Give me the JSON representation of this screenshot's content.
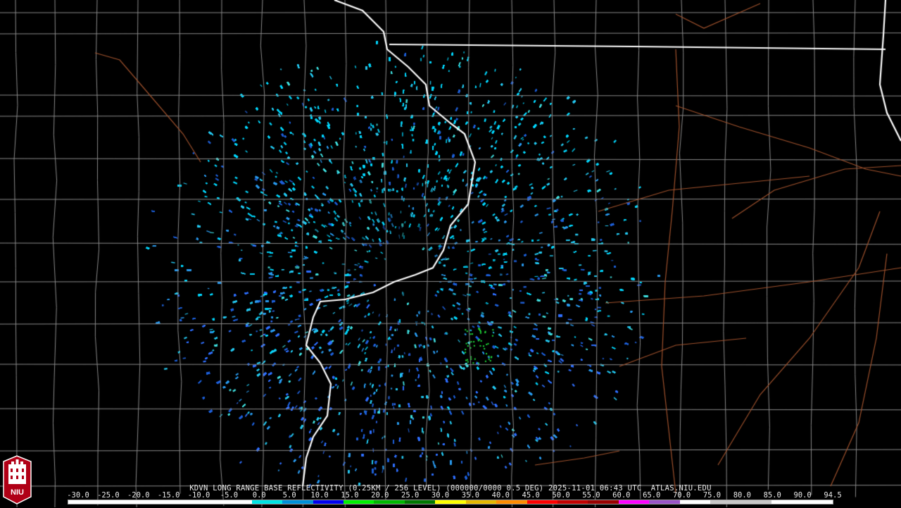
{
  "product": {
    "caption": "KDVN LONG RANGE BASE REFLECTIVITY (0.25KM / 256 LEVEL) (000000/0000 0.5 DEG) 2025-11-01 06:43 UTC  ATLAS.NIU.EDU",
    "logo_text": "NIU",
    "logo_icon": "university-tower-icon"
  },
  "colorbar": {
    "tick_labels": [
      "-30.0",
      "-25.0",
      "-20.0",
      "-15.0",
      "-10.0",
      "-5.0",
      "0.0",
      "5.0",
      "10.0",
      "15.0",
      "20.0",
      "25.0",
      "30.0",
      "35.0",
      "40.0",
      "45.0",
      "50.0",
      "55.0",
      "60.0",
      "65.0",
      "70.0",
      "75.0",
      "80.0",
      "85.0",
      "90.0",
      "94.5"
    ],
    "colors": [
      "#ffffff",
      "#ffffff",
      "#ffffff",
      "#ffffff",
      "#ffffff",
      "#ffffff",
      "#00e4e4",
      "#0090d8",
      "#0000f0",
      "#00f000",
      "#00b800",
      "#007800",
      "#ffff00",
      "#e6b800",
      "#ff8c00",
      "#ff0000",
      "#c40000",
      "#9a0000",
      "#ff00ff",
      "#9a54c8",
      "#ffffff",
      "#c8c8c8",
      "#c8c8c8",
      "#ffffff",
      "#ffffff"
    ]
  },
  "map": {
    "radar_site": "KDVN",
    "state_border_color": "#ffffff",
    "county_line_color": "#8a8a8a",
    "highway_color": "#a0522d",
    "echo_colors": [
      "#00d8ff",
      "#25c8f0",
      "#2a9aee",
      "#3070ff",
      "#1f60d8",
      "#40e0e0"
    ],
    "highlight_echo_color": "#1fe03a"
  }
}
